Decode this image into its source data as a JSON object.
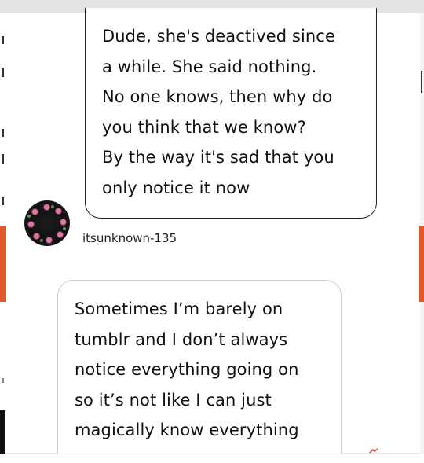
{
  "message_top": {
    "lines": [
      "Dude, she's deactived since",
      "a while. She said nothing.",
      "No one knows, then why do",
      "you think that we know?",
      "By the way it's sad that you",
      "only notice it now"
    ]
  },
  "reply": {
    "username": "itsunknown-135",
    "lines": [
      "Sometimes I’m barely on",
      "tumblr and I don’t always",
      "notice everything going on",
      "so it’s not like I can just",
      "magically know everything"
    ]
  },
  "icons": {
    "avatar": "floral-avatar-icon",
    "corner": "small-red-icon"
  },
  "colors": {
    "accent_orange": "#e4582b",
    "text": "#111111",
    "bubble_border_dark": "#222222",
    "bubble_border_light": "#cfcfcf"
  }
}
